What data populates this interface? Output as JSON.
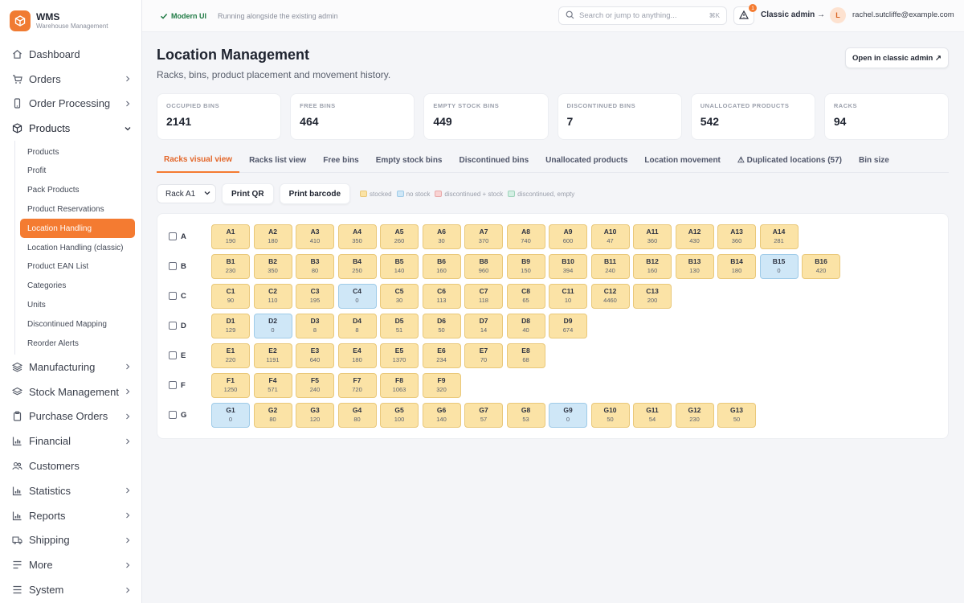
{
  "app": {
    "title": "WMS",
    "subtitle": "Warehouse Management"
  },
  "sidebar": {
    "items": [
      {
        "label": "Dashboard",
        "icon": "home-icon",
        "chevron": false
      },
      {
        "label": "Orders",
        "icon": "cart-icon",
        "chevron": true
      },
      {
        "label": "Order Processing",
        "icon": "phone-icon",
        "chevron": true
      },
      {
        "label": "Products",
        "icon": "box-icon",
        "chevron": true,
        "expanded": true
      }
    ],
    "sub_items": [
      {
        "label": "Products"
      },
      {
        "label": "Profit"
      },
      {
        "label": "Pack Products"
      },
      {
        "label": "Product Reservations"
      },
      {
        "label": "Location Handling",
        "active": true
      },
      {
        "label": "Location Handling (classic)"
      },
      {
        "label": "Product EAN List"
      },
      {
        "label": "Categories"
      },
      {
        "label": "Units"
      },
      {
        "label": "Discontinued Mapping"
      },
      {
        "label": "Reorder Alerts"
      }
    ],
    "items_after": [
      {
        "label": "Manufacturing",
        "icon": "layers-icon"
      },
      {
        "label": "Stock Management",
        "icon": "stack-icon"
      },
      {
        "label": "Purchase Orders",
        "icon": "clipboard-icon"
      },
      {
        "label": "Financial",
        "icon": "bar-chart-icon"
      },
      {
        "label": "Customers",
        "icon": "users-icon",
        "no_chevron": true
      },
      {
        "label": "Statistics",
        "icon": "bar-chart-icon"
      },
      {
        "label": "Reports",
        "icon": "bar-chart-icon"
      },
      {
        "label": "Shipping",
        "icon": "truck-icon"
      },
      {
        "label": "More",
        "icon": "more-icon"
      },
      {
        "label": "System",
        "icon": "menu-icon"
      }
    ]
  },
  "topbar": {
    "modern_ui": "Modern UI",
    "running_text": "Running alongside the existing admin",
    "search_placeholder": "Search or jump to anything...",
    "search_kbd": "⌘K",
    "alert_count": "1",
    "classic_admin": "Classic admin →",
    "avatar_initial": "L",
    "email": "rachel.sutcliffe@example.com"
  },
  "page": {
    "title": "Location Management",
    "subtitle": "Racks, bins, product placement and movement history.",
    "open_classic": "Open in classic admin ↗"
  },
  "stats": [
    {
      "label": "Occupied bins",
      "value": "2141"
    },
    {
      "label": "Free bins",
      "value": "464"
    },
    {
      "label": "Empty stock bins",
      "value": "449"
    },
    {
      "label": "Discontinued bins",
      "value": "7"
    },
    {
      "label": "Unallocated products",
      "value": "542"
    },
    {
      "label": "Racks",
      "value": "94"
    }
  ],
  "tabs": [
    {
      "label": "Racks visual view",
      "active": true
    },
    {
      "label": "Racks list view"
    },
    {
      "label": "Free bins"
    },
    {
      "label": "Empty stock bins"
    },
    {
      "label": "Discontinued bins"
    },
    {
      "label": "Unallocated products"
    },
    {
      "label": "Location movement"
    },
    {
      "label": "⚠ Duplicated locations (57)"
    },
    {
      "label": "Bin size"
    }
  ],
  "controls": {
    "rack_select": "Rack A1",
    "print_qr": "Print QR",
    "print_barcode": "Print barcode"
  },
  "legend": [
    {
      "label": "stocked",
      "fill": "#fbe3a6",
      "border": "#e9c87a"
    },
    {
      "label": "no stock",
      "fill": "#cfe7f7",
      "border": "#9fcbe8"
    },
    {
      "label": "discontinued + stock",
      "fill": "#f9d3d3",
      "border": "#e8a9a9"
    },
    {
      "label": "discontinued, empty",
      "fill": "#d3efe3",
      "border": "#9fd3bb"
    }
  ],
  "rack_rows": [
    {
      "label": "A",
      "bins": [
        [
          "A1",
          "190"
        ],
        [
          "A2",
          "180"
        ],
        [
          "A3",
          "410"
        ],
        [
          "A4",
          "350"
        ],
        [
          "A5",
          "260"
        ],
        [
          "A6",
          "30"
        ],
        [
          "A7",
          "370"
        ],
        [
          "A8",
          "740"
        ],
        [
          "A9",
          "600"
        ],
        [
          "A10",
          "47"
        ],
        [
          "A11",
          "360"
        ],
        [
          "A12",
          "430"
        ],
        [
          "A13",
          "360"
        ],
        [
          "A14",
          "281"
        ]
      ]
    },
    {
      "label": "B",
      "bins": [
        [
          "B1",
          "230"
        ],
        [
          "B2",
          "350"
        ],
        [
          "B3",
          "80"
        ],
        [
          "B4",
          "250"
        ],
        [
          "B5",
          "140"
        ],
        [
          "B6",
          "160"
        ],
        [
          "B8",
          "960"
        ],
        [
          "B9",
          "150"
        ],
        [
          "B10",
          "394"
        ],
        [
          "B11",
          "240"
        ],
        [
          "B12",
          "160"
        ],
        [
          "B13",
          "130"
        ],
        [
          "B14",
          "180"
        ],
        [
          "B15",
          "0"
        ],
        [
          "B16",
          "420"
        ]
      ]
    },
    {
      "label": "C",
      "bins": [
        [
          "C1",
          "90"
        ],
        [
          "C2",
          "110"
        ],
        [
          "C3",
          "195"
        ],
        [
          "C4",
          "0"
        ],
        [
          "C5",
          "30"
        ],
        [
          "C6",
          "113"
        ],
        [
          "C7",
          "118"
        ],
        [
          "C8",
          "65"
        ],
        [
          "C11",
          "10"
        ],
        [
          "C12",
          "4460"
        ],
        [
          "C13",
          "200"
        ]
      ]
    },
    {
      "label": "D",
      "bins": [
        [
          "D1",
          "129"
        ],
        [
          "D2",
          "0"
        ],
        [
          "D3",
          "8"
        ],
        [
          "D4",
          "8"
        ],
        [
          "D5",
          "51"
        ],
        [
          "D6",
          "50"
        ],
        [
          "D7",
          "14"
        ],
        [
          "D8",
          "40"
        ],
        [
          "D9",
          "674"
        ]
      ]
    },
    {
      "label": "E",
      "bins": [
        [
          "E1",
          "220"
        ],
        [
          "E2",
          "1191"
        ],
        [
          "E3",
          "640"
        ],
        [
          "E4",
          "180"
        ],
        [
          "E5",
          "1370"
        ],
        [
          "E6",
          "234"
        ],
        [
          "E7",
          "70"
        ],
        [
          "E8",
          "68"
        ]
      ]
    },
    {
      "label": "F",
      "bins": [
        [
          "F1",
          "1250"
        ],
        [
          "F4",
          "571"
        ],
        [
          "F5",
          "240"
        ],
        [
          "F7",
          "720"
        ],
        [
          "F8",
          "1063"
        ],
        [
          "F9",
          "320"
        ]
      ]
    },
    {
      "label": "G",
      "bins": [
        [
          "G1",
          "0"
        ],
        [
          "G2",
          "80"
        ],
        [
          "G3",
          "120"
        ],
        [
          "G4",
          "80"
        ],
        [
          "G5",
          "100"
        ],
        [
          "G6",
          "140"
        ],
        [
          "G7",
          "57"
        ],
        [
          "G8",
          "53"
        ],
        [
          "G9",
          "0"
        ],
        [
          "G10",
          "50"
        ],
        [
          "G11",
          "54"
        ],
        [
          "G12",
          "230"
        ],
        [
          "G13",
          "50"
        ]
      ]
    }
  ],
  "colors": {
    "accent": "#f47b31",
    "stocked": "#fbe3a6",
    "no_stock": "#cfe7f7"
  }
}
